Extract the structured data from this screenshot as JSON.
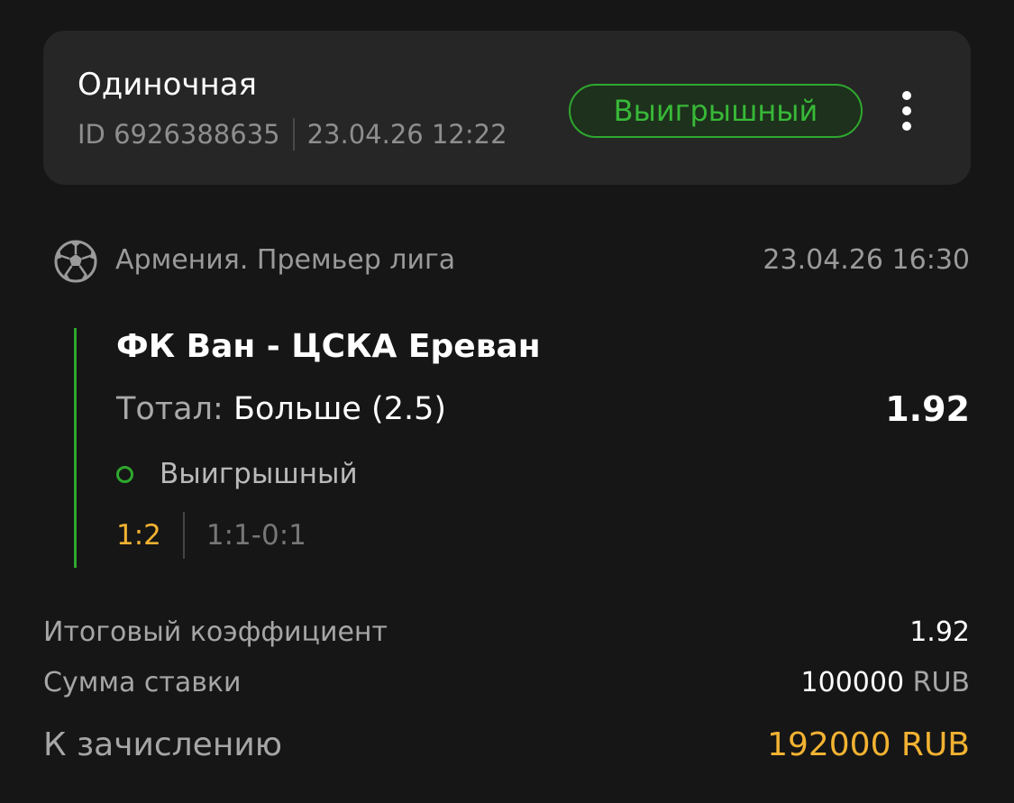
{
  "header": {
    "bet_type": "Одиночная",
    "id_text": "ID 6926388635",
    "datetime": "23.04.26 12:22",
    "status": "Выигрышный"
  },
  "event": {
    "league": "Армения. Премьер лига",
    "start_time": "23.04.26 16:30",
    "match": "ФК Ван - ЦСКА Ереван",
    "market_label": "Тотал:",
    "market_value": "Больше (2.5)",
    "odds": "1.92",
    "outcome": "Выигрышный",
    "score_final": "1:2",
    "score_periods": "1:1-0:1"
  },
  "summary": {
    "total_odds_label": "Итоговый коэффициент",
    "total_odds": "1.92",
    "stake_label": "Сумма ставки",
    "stake_amount": "100000",
    "stake_currency": "RUB",
    "payout_label": "К зачислению",
    "payout_amount": "192000 RUB"
  },
  "colors": {
    "background": "#161616",
    "card": "#262626",
    "win_green": "#2ea82e",
    "accent_gold": "#f2b232"
  }
}
